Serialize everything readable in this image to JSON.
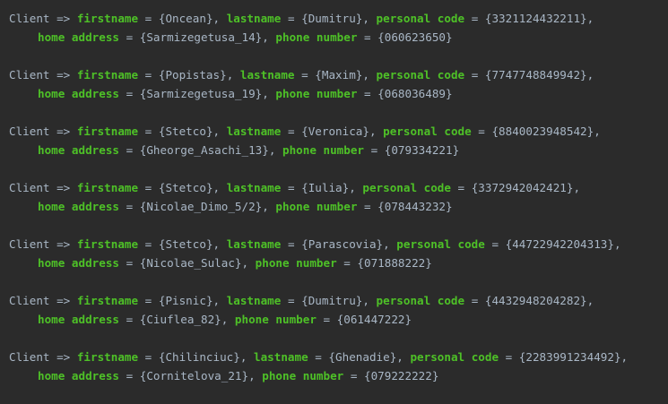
{
  "theme": {
    "background": "#2b2b2b",
    "text_color": "#a9b7c6",
    "keyword_color": "#4ec127"
  },
  "labels": {
    "prefix": "Client =>",
    "firstname": "firstname",
    "lastname": "lastname",
    "personal_code": "personal code",
    "home_address": "home address",
    "phone_number": "phone number"
  },
  "records": [
    {
      "firstname": "Oncean",
      "lastname": "Dumitru",
      "personal_code": "3321124432211",
      "home_address": "Sarmizegetusa_14",
      "phone_number": "060623650"
    },
    {
      "firstname": "Popistas",
      "lastname": "Maxim",
      "personal_code": "7747748849942",
      "home_address": "Sarmizegetusa_19",
      "phone_number": "068036489"
    },
    {
      "firstname": "Stetco",
      "lastname": "Veronica",
      "personal_code": "8840023948542",
      "home_address": "Gheorge_Asachi_13",
      "phone_number": "079334221"
    },
    {
      "firstname": "Stetco",
      "lastname": "Iulia",
      "personal_code": "3372942042421",
      "home_address": "Nicolae_Dimo_5/2",
      "phone_number": "078443232"
    },
    {
      "firstname": "Stetco",
      "lastname": "Parascovia",
      "personal_code": "44722942204313",
      "home_address": "Nicolae_Sulac",
      "phone_number": "071888222"
    },
    {
      "firstname": "Pisnic",
      "lastname": "Dumitru",
      "personal_code": "4432948204282",
      "home_address": "Ciuflea_82",
      "phone_number": "061447222"
    },
    {
      "firstname": "Chilinciuc",
      "lastname": "Ghenadie",
      "personal_code": "2283991234492",
      "home_address": "Cornitelova_21",
      "phone_number": "079222222"
    }
  ]
}
